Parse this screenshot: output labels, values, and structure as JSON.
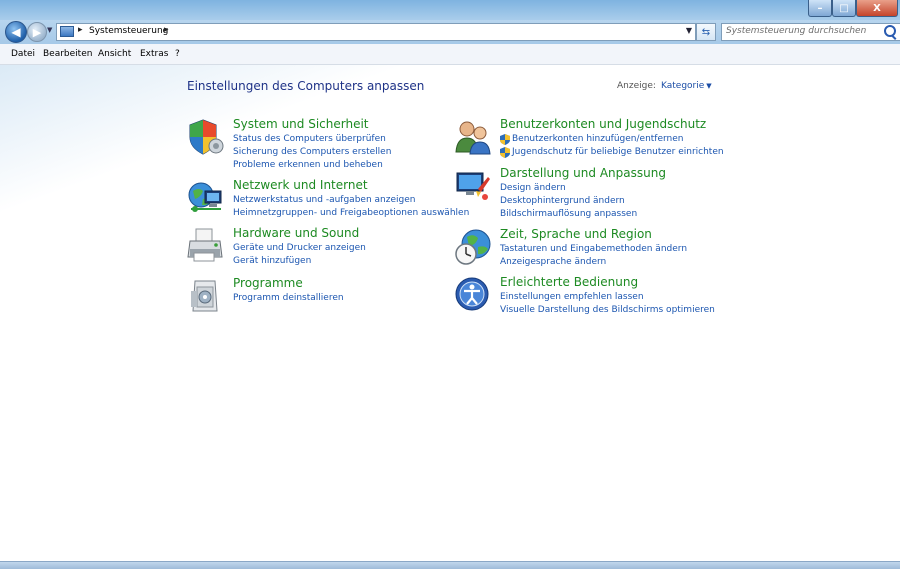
{
  "window": {
    "caption_buttons": {
      "minimize": "–",
      "maximize": "□",
      "close": "X"
    }
  },
  "navigation": {
    "back_icon": "arrow-left-icon",
    "forward_icon": "arrow-right-icon",
    "breadcrumb": [
      "Systemsteuerung"
    ],
    "search_placeholder": "Systemsteuerung durchsuchen"
  },
  "menu": [
    "Datei",
    "Bearbeiten",
    "Ansicht",
    "Extras",
    "?"
  ],
  "main": {
    "title": "Einstellungen des Computers anpassen",
    "view_label": "Anzeige:",
    "view_value": "Kategorie"
  },
  "categories": [
    {
      "title": "System und Sicherheit",
      "icon": "shield-flag-icon",
      "links": [
        "Status des Computers überprüfen",
        "Sicherung des Computers erstellen",
        "Probleme erkennen und beheben"
      ]
    },
    {
      "title": "Netzwerk und Internet",
      "icon": "network-globe-icon",
      "links": [
        "Netzwerkstatus und -aufgaben anzeigen",
        "Heimnetzgruppen- und Freigabeoptionen auswählen"
      ]
    },
    {
      "title": "Hardware und Sound",
      "icon": "printer-icon",
      "links": [
        "Geräte und Drucker anzeigen",
        "Gerät hinzufügen"
      ]
    },
    {
      "title": "Programme",
      "icon": "programs-box-icon",
      "links": [
        "Programm deinstallieren"
      ]
    },
    {
      "title": "Benutzerkonten und Jugendschutz",
      "icon": "users-icon",
      "links": [
        "Benutzerkonten hinzufügen/entfernen",
        "Jugendschutz für beliebige Benutzer einrichten"
      ]
    },
    {
      "title": "Darstellung und Anpassung",
      "icon": "display-paint-icon",
      "links": [
        "Design ändern",
        "Desktophintergrund ändern",
        "Bildschirmauflösung anpassen"
      ]
    },
    {
      "title": "Zeit, Sprache und Region",
      "icon": "globe-clock-icon",
      "links": [
        "Tastaturen und Eingabemethoden ändern",
        "Anzeigesprache ändern"
      ]
    },
    {
      "title": "Erleichterte Bedienung",
      "icon": "ease-of-access-icon",
      "links": [
        "Einstellungen empfehlen lassen",
        "Visuelle Darstellung des Bildschirms optimieren"
      ]
    }
  ]
}
